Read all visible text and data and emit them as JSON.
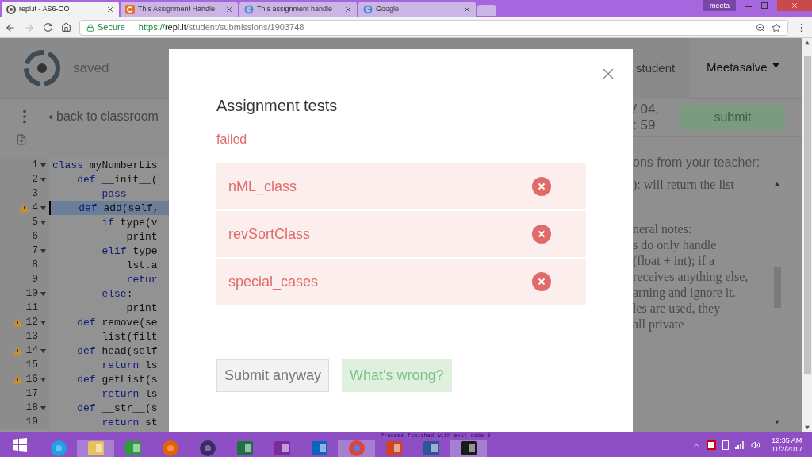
{
  "browser": {
    "tabs": [
      {
        "title": "repl.it - AS6-OO",
        "kind": "repl",
        "selected": true
      },
      {
        "title": "This Assignment Handle",
        "kind": "c",
        "selected": false
      },
      {
        "title": "This assignment handle",
        "kind": "g",
        "selected": false
      },
      {
        "title": "Google",
        "kind": "g",
        "selected": false
      }
    ],
    "profile": "meeta",
    "address": {
      "secure_label": "Secure",
      "scheme": "https://",
      "host": "repl.it",
      "path": "/student/submissions/1903748"
    }
  },
  "header": {
    "status": "saved",
    "back_link": "back to classroom",
    "role_label": "student",
    "user_menu": "Meetasalve"
  },
  "due": {
    "lines": [
      "/ 04,",
      ": 59"
    ],
    "submit": "submit"
  },
  "editor": {
    "lines": [
      {
        "number": "1",
        "keyword": "class",
        "rest": " myNumberLis",
        "fold": true,
        "warning": false,
        "selected": false
      },
      {
        "number": "2",
        "keyword": "    def",
        "rest": " __init__(",
        "fold": true,
        "warning": false,
        "selected": false
      },
      {
        "number": "3",
        "keyword": "        pass",
        "fold": false,
        "warning": false,
        "selected": false
      },
      {
        "number": "4",
        "keyword": "    def",
        "rest": " add(self,",
        "fold": true,
        "warning": true,
        "selected": true
      },
      {
        "number": "5",
        "keyword": "        if",
        "rest": " type(v",
        "fold": true,
        "warning": false,
        "selected": false
      },
      {
        "number": "6",
        "rest": "            print",
        "fold": false,
        "warning": false,
        "selected": false
      },
      {
        "number": "7",
        "keyword": "        elif",
        "rest": " type",
        "fold": true,
        "warning": false,
        "selected": false
      },
      {
        "number": "8",
        "rest": "            lst.a",
        "fold": false,
        "warning": false,
        "selected": false
      },
      {
        "number": "9",
        "keyword": "            retur",
        "fold": false,
        "warning": false,
        "selected": false
      },
      {
        "number": "10",
        "keyword": "        else",
        "rest": ":",
        "fold": true,
        "warning": false,
        "selected": false
      },
      {
        "number": "11",
        "rest": "            print",
        "fold": false,
        "warning": false,
        "selected": false
      },
      {
        "number": "12",
        "keyword": "    def",
        "rest": " remove(se",
        "fold": true,
        "warning": true,
        "selected": false
      },
      {
        "number": "13",
        "rest": "        list(filt",
        "fold": false,
        "warning": false,
        "selected": false
      },
      {
        "number": "14",
        "keyword": "    def",
        "rest": " head(self",
        "fold": true,
        "warning": true,
        "selected": false
      },
      {
        "number": "15",
        "keyword": "        return",
        "rest": " ls",
        "fold": false,
        "warning": false,
        "selected": false
      },
      {
        "number": "16",
        "keyword": "    def",
        "rest": " getList(s",
        "fold": true,
        "warning": true,
        "selected": false
      },
      {
        "number": "17",
        "keyword": "        return",
        "rest": " ls",
        "fold": false,
        "warning": false,
        "selected": false
      },
      {
        "number": "18",
        "keyword": "    def",
        "rest": " __str__(s",
        "fold": true,
        "warning": false,
        "selected": false
      },
      {
        "number": "19",
        "keyword": "        return",
        "rest": " st",
        "fold": false,
        "warning": false,
        "selected": false
      }
    ]
  },
  "instructions": {
    "heading": "ons from your teacher:",
    "lines": [
      "): will return the list",
      "neral notes:",
      "s do only handle",
      "(float + int); if a",
      "receives anything else,",
      "arning and ignore it.",
      "les are used, they",
      "all private"
    ]
  },
  "modal": {
    "title": "Assignment tests",
    "status": "failed",
    "tests": [
      {
        "name": "nML_class",
        "passed": false
      },
      {
        "name": "revSortClass",
        "passed": false
      },
      {
        "name": "special_cases",
        "passed": false
      }
    ],
    "buttons": [
      {
        "label": "Submit anyway",
        "kind": "secondary"
      },
      {
        "label": "What's wrong?",
        "kind": "success"
      }
    ]
  },
  "taskbar": {
    "apps": [
      {
        "kind": "ie",
        "selected": false
      },
      {
        "kind": "explorer",
        "selected": true
      },
      {
        "kind": "store",
        "selected": false
      },
      {
        "kind": "firefox",
        "selected": false
      },
      {
        "kind": "eclipse",
        "selected": false
      },
      {
        "kind": "excel",
        "selected": false
      },
      {
        "kind": "onenote",
        "selected": false
      },
      {
        "kind": "outlook",
        "selected": false
      },
      {
        "kind": "chrome",
        "selected": true
      },
      {
        "kind": "powerpoint",
        "selected": false
      },
      {
        "kind": "word",
        "selected": false
      },
      {
        "kind": "pycharm",
        "selected": true
      }
    ],
    "console_text": "Process finished with exit code 0",
    "time": "12:35 AM",
    "date": "11/2/2017"
  }
}
